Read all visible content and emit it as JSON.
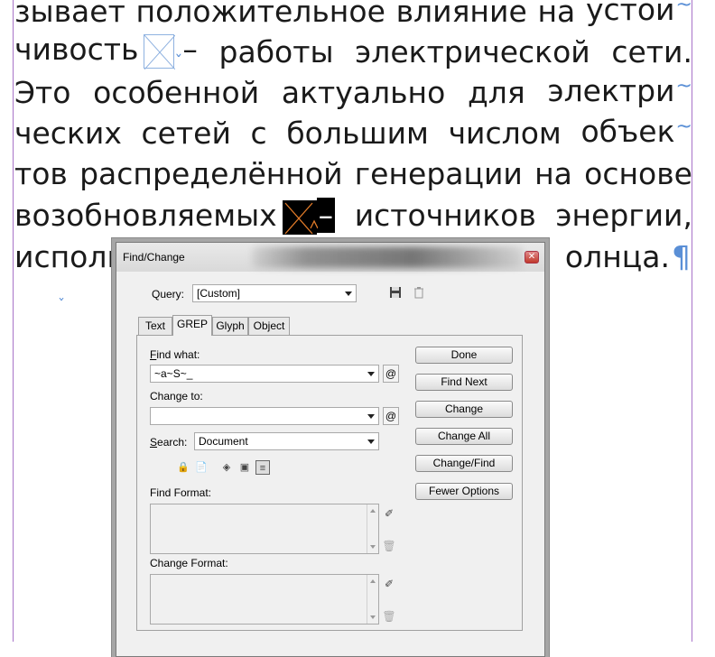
{
  "document": {
    "lines": [
      [
        "зывает",
        "положительное",
        "влияние",
        "на",
        "устои"
      ],
      [
        "чивость",
        "–",
        "работы",
        "электрической",
        "сети."
      ],
      [
        "Это",
        "особенной",
        "актуально",
        "для",
        "электри"
      ],
      [
        "ческих",
        "сетей",
        "с",
        "большим",
        "числом",
        "объек"
      ],
      [
        "тов",
        "распределённой",
        "генерации",
        "на",
        "основе"
      ],
      [
        "возобновляемых",
        "источников",
        "энергии,"
      ],
      [
        "исполь",
        "олнца."
      ]
    ],
    "discretionary_hyphen": "~",
    "pilcrow": "¶",
    "caret_glyph": "ˇ"
  },
  "dialog": {
    "title": "Find/Change",
    "close_glyph": "✕",
    "query_label": "Query:",
    "query_value": "[Custom]",
    "save_icon_glyph": "💾",
    "trash_icon_glyph": "🗑",
    "tabs": [
      "Text",
      "GREP",
      "Glyph",
      "Object"
    ],
    "active_tab": "GREP",
    "find_what_label": "Find what:",
    "find_what_value": "~a~S~_",
    "change_to_label": "Change to:",
    "change_to_value": "",
    "special_char_glyph": "@",
    "search_label": "Search:",
    "search_value": "Document",
    "find_format_label": "Find Format:",
    "change_format_label": "Change Format:",
    "buttons": {
      "done": "Done",
      "find_next": "Find Next",
      "change": "Change",
      "change_all": "Change All",
      "change_find": "Change/Find",
      "fewer_options": "Fewer Options"
    },
    "option_icons": [
      "include-locked-layers-icon",
      "include-locked-stories-icon",
      "include-hidden-layers-icon",
      "include-master-pages-icon",
      "include-footnotes-icon"
    ]
  }
}
